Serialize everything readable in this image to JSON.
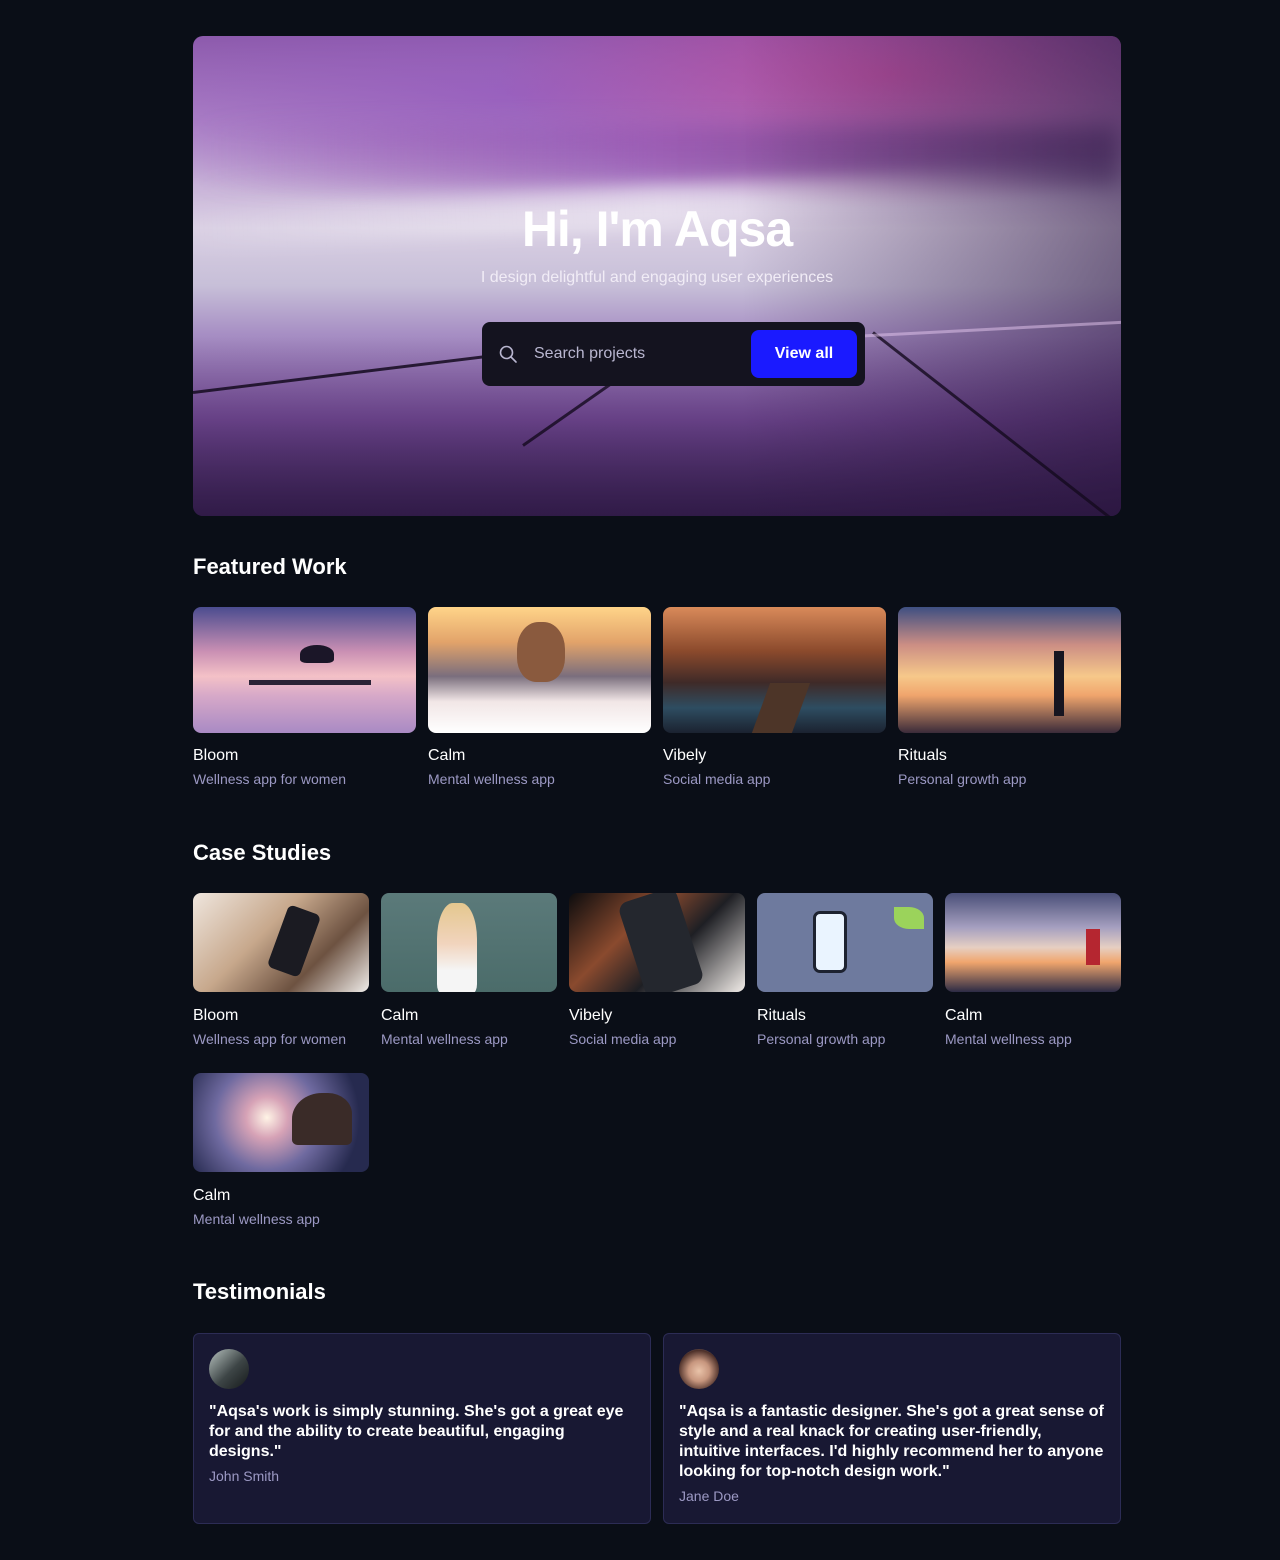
{
  "hero": {
    "title": "Hi, I'm Aqsa",
    "subtitle": "I design delightful and engaging user experiences",
    "search_placeholder": "Search projects",
    "view_all_label": "View all"
  },
  "featured": {
    "title": "Featured Work",
    "items": [
      {
        "title": "Bloom",
        "subtitle": "Wellness app for women"
      },
      {
        "title": "Calm",
        "subtitle": "Mental wellness app"
      },
      {
        "title": "Vibely",
        "subtitle": "Social media app"
      },
      {
        "title": "Rituals",
        "subtitle": "Personal growth app"
      }
    ]
  },
  "case_studies": {
    "title": "Case Studies",
    "items": [
      {
        "title": "Bloom",
        "subtitle": "Wellness app for women"
      },
      {
        "title": "Calm",
        "subtitle": "Mental wellness app"
      },
      {
        "title": "Vibely",
        "subtitle": "Social media app"
      },
      {
        "title": "Rituals",
        "subtitle": "Personal growth app"
      },
      {
        "title": "Calm",
        "subtitle": "Mental wellness app"
      },
      {
        "title": "Calm",
        "subtitle": "Mental wellness app"
      }
    ]
  },
  "testimonials": {
    "title": "Testimonials",
    "items": [
      {
        "quote": "\"Aqsa's work is simply stunning. She's got a great eye  for and the ability to create beautiful, engaging designs.\"",
        "author": "John Smith"
      },
      {
        "quote": "\"Aqsa is a fantastic designer. She's got a great sense of style and a real knack for creating user-friendly, intuitive interfaces. I'd highly recommend her to anyone looking for top-notch design work.\"",
        "author": "Jane Doe"
      }
    ]
  },
  "colors": {
    "background": "#0a0e17",
    "accent": "#1a1aff",
    "card": "#181833",
    "muted_text": "#9c99c4"
  },
  "icons": {
    "search": "search-icon"
  }
}
